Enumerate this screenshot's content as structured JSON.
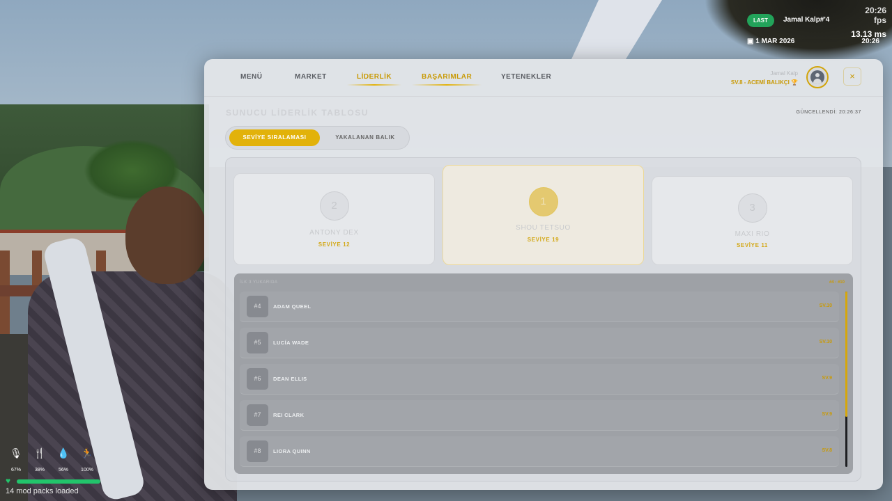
{
  "hud": {
    "badge": "LAST",
    "player": "Jamal Kalp#'4",
    "fps": "20:26\nfps",
    "ping": "13.13 ms",
    "date": "1 MAR 2026",
    "clock": "20:26",
    "accent_green": "#22a35a"
  },
  "status": {
    "mic": "67%",
    "food": "38%",
    "water": "56%",
    "stamina": "100%",
    "mods": "14 mod packs loaded"
  },
  "nav": {
    "tabs": [
      "MENÜ",
      "MARKET",
      "LİDERLİK",
      "BAŞARIMLAR",
      "YETENEKLER"
    ],
    "active": "LİDERLİK",
    "accent": "#e2b20a"
  },
  "profile": {
    "name": "Jamal Kalp",
    "level": "SV.8 - ACEMİ BALIKÇI",
    "close": "×"
  },
  "board": {
    "title": "SUNUCU LİDERLİK TABLOSU",
    "updated": "GÜNCELLENDİ: 20:26:37",
    "segments": [
      "SEVİYE SIRALAMASI",
      "YAKALANAN BALIK"
    ],
    "podium": [
      {
        "rank": "2",
        "name": "ANTONY DEX",
        "level": "SEVİYE 12"
      },
      {
        "rank": "1",
        "name": "SHOU TETSUO",
        "level": "SEVİYE 19"
      },
      {
        "rank": "3",
        "name": "MAXI RIO",
        "level": "SEVİYE 11"
      }
    ],
    "list_header": "İLK 3 YUKARIDA",
    "list_header_right": "#4 - #10",
    "rows": [
      {
        "rank": "#4",
        "name": "ADAM QUEEL",
        "level": "SV.10"
      },
      {
        "rank": "#5",
        "name": "LUCÍA WADE",
        "level": "SV.10"
      },
      {
        "rank": "#6",
        "name": "DEAN ELLIS",
        "level": "SV.9"
      },
      {
        "rank": "#7",
        "name": "REI CLARK",
        "level": "SV.9"
      },
      {
        "rank": "#8",
        "name": "LIORA QUINN",
        "level": "SV.8"
      }
    ]
  }
}
